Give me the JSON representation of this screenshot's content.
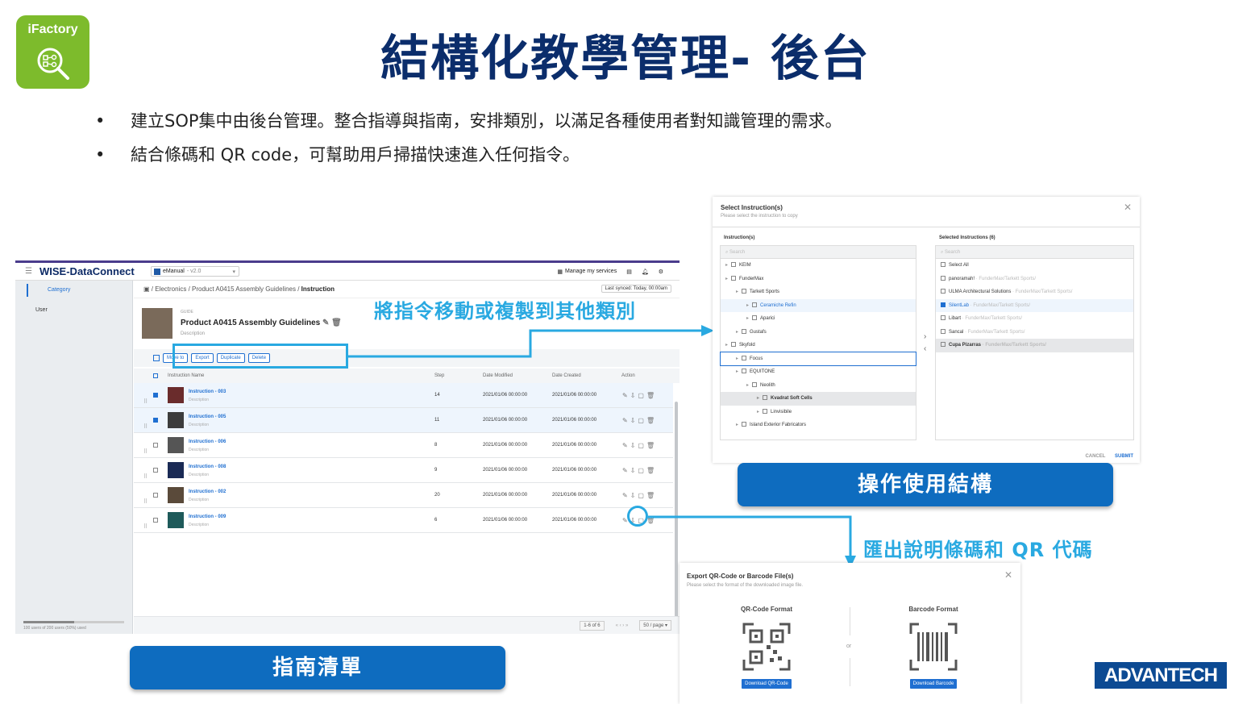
{
  "logo": {
    "text": "iFactory"
  },
  "title": "結構化教學管理- 後台",
  "bullets": [
    "建立SOP集中由後台管理。整合指導與指南，安排類別，以滿足各種使用者對知識管理的需求。",
    "結合條碼和 QR code，可幫助用戶掃描快速進入任何指令。"
  ],
  "app": {
    "brand": "WISE-DataConnect",
    "selector": "eManual",
    "version": "- v2.0",
    "services": "Manage my services",
    "nav": {
      "category": "Category",
      "user": "User"
    },
    "usage": "100 users of 200 users (50%) used",
    "breadcrumb": [
      "Electronics",
      "Product A0415 Assembly Guidelines",
      "Instruction"
    ],
    "sync": "Last synced: Today, 00:00am",
    "guide": {
      "tag": "GUIDE",
      "name": "Product A0415 Assembly Guidelines",
      "desc": "Description"
    },
    "toolbar": {
      "move": "Move to",
      "export": "Export",
      "duplicate": "Duplicate",
      "delete": "Delete"
    },
    "columns": {
      "name": "Instruction Name",
      "step": "Step",
      "modified": "Date Modified",
      "created": "Date Created",
      "action": "Action"
    },
    "rows": [
      {
        "name": "Instruction - 003",
        "desc": "Description",
        "step": "14",
        "modified": "2021/01/06 00:00:00",
        "created": "2021/01/06 00:00:00",
        "checked": true
      },
      {
        "name": "Instruction - 005",
        "desc": "Description",
        "step": "11",
        "modified": "2021/01/06 00:00:00",
        "created": "2021/01/06 00:00:00",
        "checked": true
      },
      {
        "name": "Instruction - 006",
        "desc": "Description",
        "step": "8",
        "modified": "2021/01/06 00:00:00",
        "created": "2021/01/06 00:00:00",
        "checked": false
      },
      {
        "name": "Instruction - 008",
        "desc": "Description",
        "step": "9",
        "modified": "2021/01/06 00:00:00",
        "created": "2021/01/06 00:00:00",
        "checked": false
      },
      {
        "name": "Instruction - 002",
        "desc": "Description",
        "step": "20",
        "modified": "2021/01/06 00:00:00",
        "created": "2021/01/06 00:00:00",
        "checked": false
      },
      {
        "name": "Instruction - 009",
        "desc": "Description",
        "step": "6",
        "modified": "2021/01/06 00:00:00",
        "created": "2021/01/06 00:00:00",
        "checked": false
      }
    ],
    "pager": {
      "count": "1-6 of 6",
      "nav": "« ‹ › »",
      "size": "50 / page ▾"
    }
  },
  "callouts": {
    "move": "將指令移動或複製到其他類別",
    "export": "匯出說明條碼和 QR 代碼"
  },
  "buttons": {
    "structure": "操作使用結構",
    "list": "指南清單"
  },
  "select_dialog": {
    "title": "Select Instruction(s)",
    "subtitle": "Please select the instruction to copy",
    "left_label": "Instruction(s)",
    "right_label": "Selected Instructions (6)",
    "search": "Search",
    "tree": [
      "KEIM",
      "FunderMax",
      "Tarkett Sports",
      "Ceramiche Refin",
      "Aparici",
      "Gustafs",
      "Skyfold",
      "Focus",
      "EQUITONE",
      "Neolith",
      "Kvadrat Soft Cells",
      "Linvisibile",
      "Island Exterior Fabricators"
    ],
    "selected": [
      {
        "name": "Select All",
        "path": ""
      },
      {
        "name": "panoramah!",
        "path": "· FunderMax/Tarkett Sports/"
      },
      {
        "name": "ULMA Architectural Solutions",
        "path": "· FunderMax/Tarkett Sports/"
      },
      {
        "name": "SilentLab",
        "path": "· FunderMax/Tarkett Sports/"
      },
      {
        "name": "Libart",
        "path": "· FunderMax/Tarkett Sports/"
      },
      {
        "name": "Sancal",
        "path": "· FunderMax/Tarkett Sports/"
      },
      {
        "name": "Cupa Pizarras",
        "path": "· FunderMax/Tarkett Sports/"
      }
    ],
    "cancel": "CANCEL",
    "submit": "SUBMIT"
  },
  "export_dialog": {
    "title": "Export QR-Code or Barcode File(s)",
    "subtitle": "Please select the format of the downloaded image file.",
    "qr_title": "QR-Code Format",
    "qr_button": "Download QR-Code",
    "or": "or",
    "bar_title": "Barcode Format",
    "bar_button": "Download Barcode"
  },
  "footer_logo": "ADVANTECH",
  "colors": {
    "navy": "#0b2d6b",
    "green": "#7dbb2c",
    "cyan": "#29a9e1",
    "blue": "#0e6cbf"
  }
}
